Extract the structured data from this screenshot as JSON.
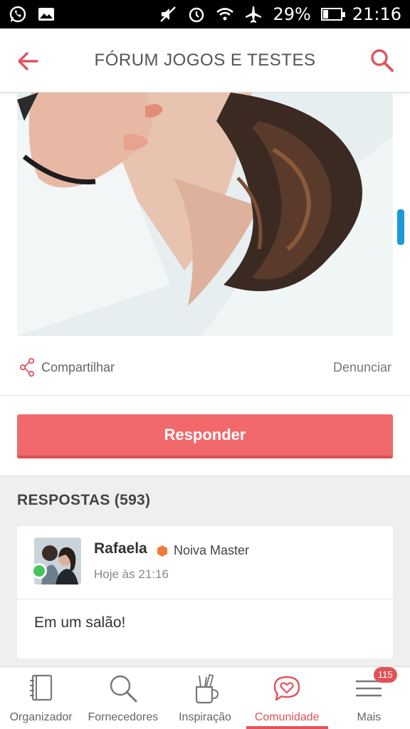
{
  "status_bar": {
    "battery_percent": "29%",
    "battery_level": 0.29,
    "time": "21:16"
  },
  "header": {
    "title": "FÓRUM JOGOS E TESTES"
  },
  "post": {
    "share_label": "Compartilhar",
    "report_label": "Denunciar"
  },
  "reply_button_label": "Responder",
  "replies": {
    "title": "RESPOSTAS (593)",
    "items": [
      {
        "name": "Rafaela",
        "rank": "Noiva Master",
        "time": "Hoje às 21:16",
        "text": "Em um salão!",
        "online": true
      }
    ]
  },
  "bottom_nav": {
    "items": [
      {
        "label": "Organizador",
        "icon": "notebook-icon"
      },
      {
        "label": "Fornecedores",
        "icon": "search-icon"
      },
      {
        "label": "Inspiração",
        "icon": "pencil-cup-icon"
      },
      {
        "label": "Comunidade",
        "icon": "heart-chat-icon",
        "active": true
      },
      {
        "label": "Mais",
        "icon": "menu-icon",
        "badge": "115"
      }
    ]
  },
  "colors": {
    "accent": "#f2696c",
    "accent_dark": "#e0545a",
    "online": "#47c35a",
    "scroll_indicator": "#1a9bd7",
    "rank_badge": "#f07a3a"
  }
}
